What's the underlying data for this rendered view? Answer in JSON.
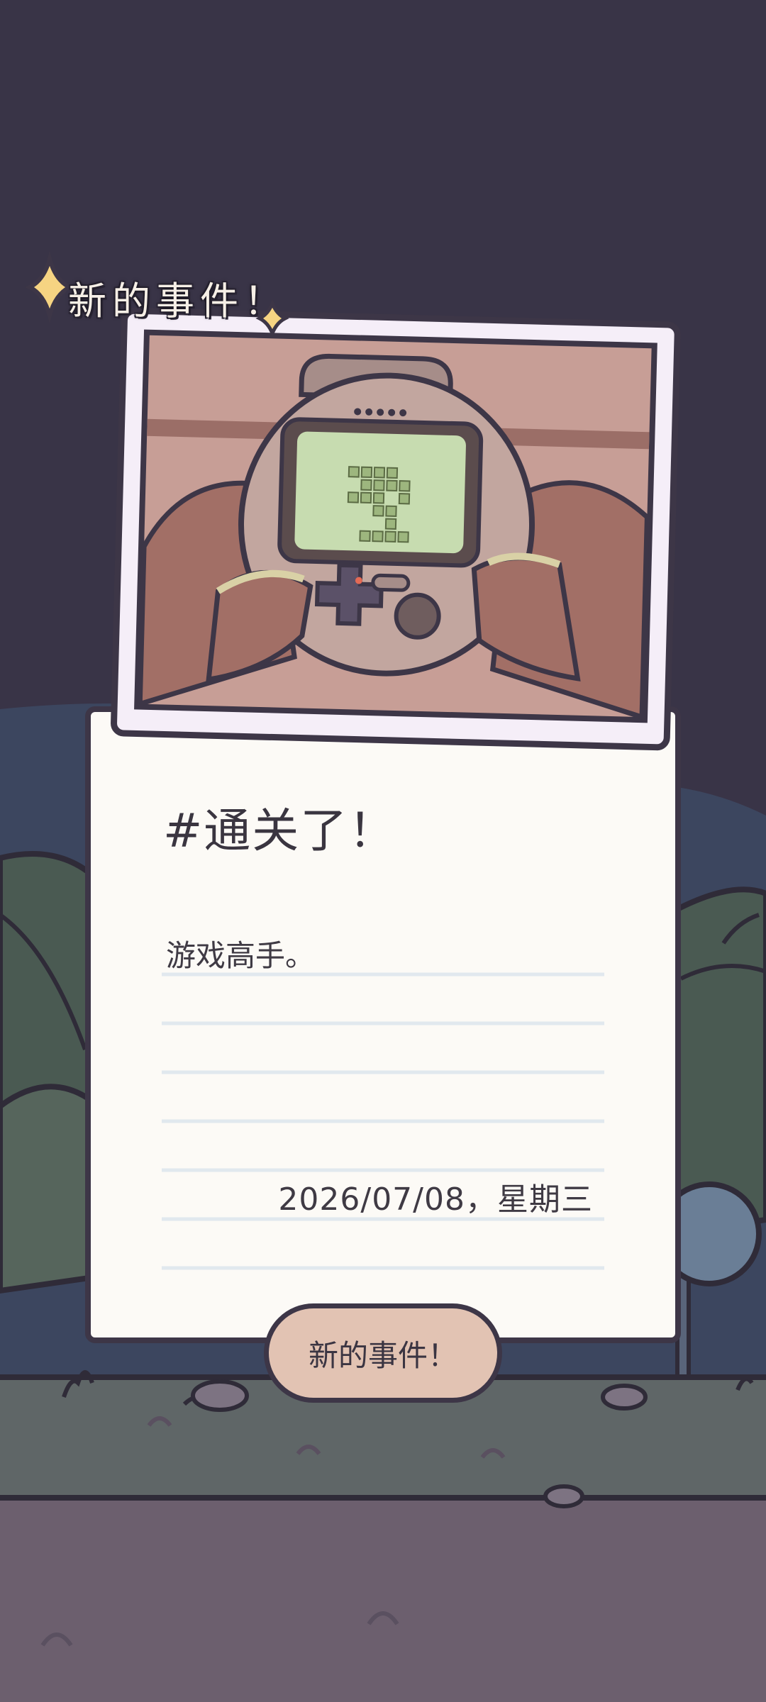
{
  "header": {
    "label": "新的事件！"
  },
  "card": {
    "title": "#通关了！",
    "entry_text": "游戏高手。",
    "date": "2026/07/08，星期三"
  },
  "button": {
    "label": "新的事件！"
  },
  "colors": {
    "night_sky": "#393447",
    "card_bg": "#fcfaf6",
    "button_bg": "#e2c3b3",
    "outline": "#3d3647",
    "sparkle": "#f6d482"
  },
  "icons": {
    "sparkle": "sparkle-icon",
    "handheld_console": "handheld-console-illustration"
  }
}
